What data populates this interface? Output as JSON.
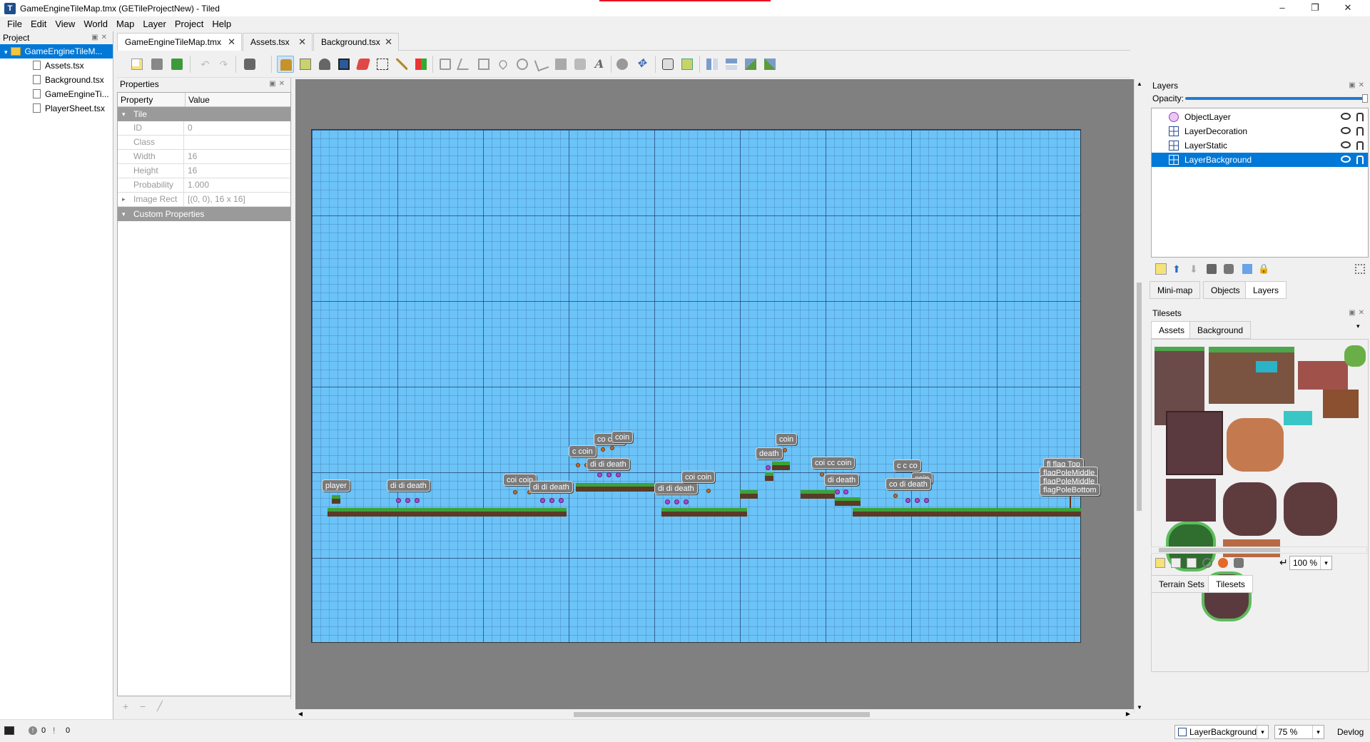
{
  "window": {
    "title": "GameEngineTileMap.tmx (GETileProjectNew) - Tiled",
    "minimize": "–",
    "maximize": "❐",
    "close": "✕"
  },
  "menu": [
    "File",
    "Edit",
    "View",
    "World",
    "Map",
    "Layer",
    "Project",
    "Help"
  ],
  "project": {
    "header": "Project",
    "root": "GameEngineTileM...",
    "files": [
      "Assets.tsx",
      "Background.tsx",
      "GameEngineTi...",
      "PlayerSheet.tsx"
    ]
  },
  "tabs": [
    "GameEngineTileMap.tmx",
    "Assets.tsx",
    "Background.tsx"
  ],
  "properties": {
    "header": "Properties",
    "col_property": "Property",
    "col_value": "Value",
    "section_tile": "Tile",
    "rows": [
      {
        "key": "ID",
        "value": "0"
      },
      {
        "key": "Class",
        "value": ""
      },
      {
        "key": "Width",
        "value": "16"
      },
      {
        "key": "Height",
        "value": "16"
      },
      {
        "key": "Probability",
        "value": "1.000"
      },
      {
        "key": "Image Rect",
        "value": "[(0, 0), 16 x 16]"
      }
    ],
    "section_custom": "Custom Properties"
  },
  "map_objects": [
    {
      "text": "player"
    },
    {
      "text": "di di death"
    },
    {
      "text": "coi coin"
    },
    {
      "text": "di di death"
    },
    {
      "text": "co coin"
    },
    {
      "text": "c coin"
    },
    {
      "text": "coin"
    },
    {
      "text": "di di death"
    },
    {
      "text": "di di death"
    },
    {
      "text": "coi coin"
    },
    {
      "text": "coin"
    },
    {
      "text": "death"
    },
    {
      "text": "coi cc coin"
    },
    {
      "text": "di death"
    },
    {
      "text": "c c co"
    },
    {
      "text": "coin"
    },
    {
      "text": "co di death"
    },
    {
      "text": "fl flag Top"
    },
    {
      "text": "flagPoleMiddle"
    },
    {
      "text": "flagPoleMiddle"
    },
    {
      "text": "flagPoleBottom"
    }
  ],
  "layers": {
    "header": "Layers",
    "opacity_label": "Opacity:",
    "items": [
      {
        "name": "ObjectLayer",
        "type": "object"
      },
      {
        "name": "LayerDecoration",
        "type": "tile"
      },
      {
        "name": "LayerStatic",
        "type": "tile"
      },
      {
        "name": "LayerBackground",
        "type": "tile",
        "selected": true
      }
    ],
    "bottom_tabs": [
      "Mini-map",
      "Objects",
      "Layers"
    ]
  },
  "tilesets": {
    "header": "Tilesets",
    "tabs": [
      "Assets",
      "Background"
    ],
    "zoom": "100 %",
    "bottom_tabs": [
      "Terrain Sets",
      "Tilesets"
    ]
  },
  "status": {
    "errors": "0",
    "warnings": "0",
    "current_layer": "LayerBackground",
    "zoom": "75 %",
    "news": "Devlog"
  },
  "colors": {
    "accent": "#0078d7",
    "map_sky": "#6bc3f7",
    "grass": "#3aa33a",
    "dirt": "#5b3a26"
  }
}
